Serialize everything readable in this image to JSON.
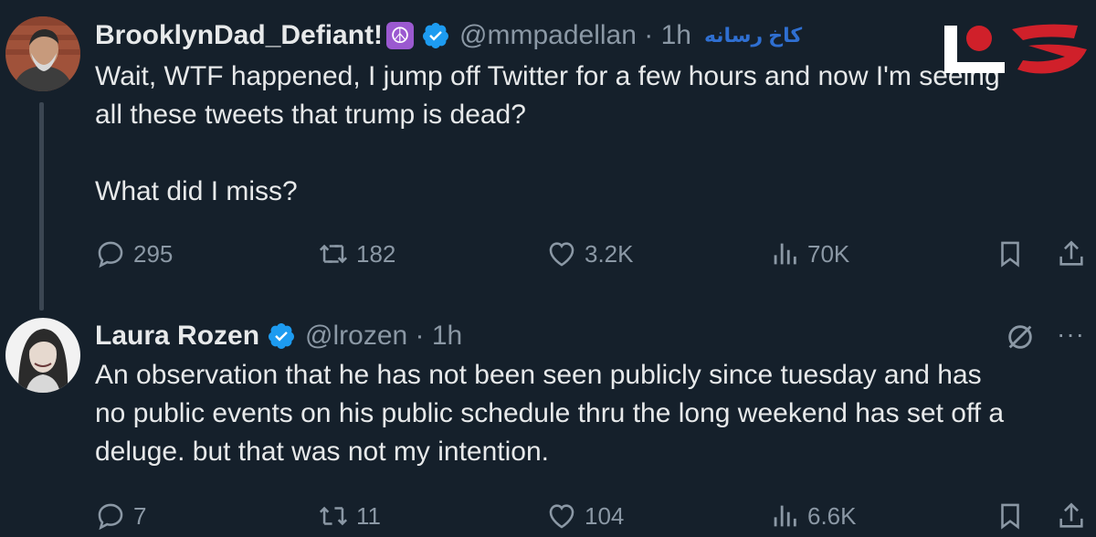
{
  "tweets": [
    {
      "name": "BrooklynDad_Defiant!",
      "emoji": "☮",
      "handle": "@mmpadellan · 1h",
      "watermark": "کاخ رسانه",
      "text_lines": [
        "Wait, WTF happened, I jump off Twitter for a few hours and now I'm seeing",
        "all these tweets that trump is dead?",
        "What did I miss?"
      ],
      "replies": "295",
      "retweets": "182",
      "likes": "3.2K",
      "views": "70K"
    },
    {
      "name": "Laura Rozen",
      "handle": "@lrozen · 1h",
      "text_lines": [
        "An observation that he has not been seen publicly since tuesday and has",
        "no public events on his public schedule thru the long weekend has set off a",
        "deluge. but that was not my intention."
      ],
      "replies": "7",
      "retweets": "11",
      "likes": "104",
      "views": "6.6K",
      "more": "···"
    }
  ],
  "colors": {
    "background": "#15202b",
    "text": "#e7e9ea",
    "muted": "#8b98a5",
    "verified": "#1d9bf0",
    "logo_red": "#d0202a"
  },
  "icons": [
    "reply-icon",
    "retweet-icon",
    "like-icon",
    "views-icon",
    "bookmark-icon",
    "share-icon",
    "verified-icon",
    "grok-icon",
    "more-icon"
  ]
}
